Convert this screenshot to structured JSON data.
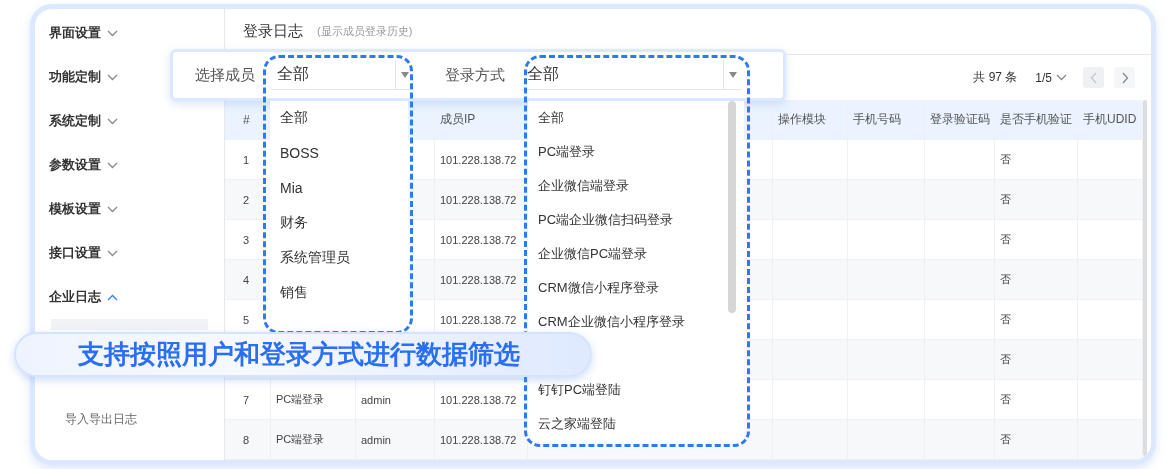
{
  "sidebar": {
    "items": [
      {
        "label": "界面设置",
        "expanded": false
      },
      {
        "label": "功能定制",
        "expanded": false
      },
      {
        "label": "系统定制",
        "expanded": false
      },
      {
        "label": "参数设置",
        "expanded": false
      },
      {
        "label": "模板设置",
        "expanded": false
      },
      {
        "label": "接口设置",
        "expanded": false
      },
      {
        "label": "企业日志",
        "expanded": true,
        "children": [
          {
            "selected": true
          },
          {
            "label": "导入导出日志",
            "selected": false
          }
        ]
      }
    ]
  },
  "header": {
    "title": "登录日志",
    "subtitle": "(显示成员登录历史)"
  },
  "pagination": {
    "total": "共 97 条",
    "page": "1/5",
    "prev_disabled": true,
    "next_disabled": false
  },
  "table": {
    "columns": [
      "#",
      null,
      null,
      "成员IP",
      null,
      "操作模块",
      "手机号码",
      "登录验证码",
      "是否手机验证",
      "手机UDID"
    ],
    "rows": [
      [
        "1",
        null,
        null,
        "101.228.138.72",
        null,
        null,
        null,
        null,
        "否",
        null
      ],
      [
        "2",
        null,
        null,
        "101.228.138.72",
        null,
        null,
        null,
        null,
        "否",
        null
      ],
      [
        "3",
        null,
        null,
        "101.228.138.72",
        null,
        null,
        null,
        null,
        "否",
        null
      ],
      [
        "4",
        null,
        null,
        "101.228.138.72",
        null,
        null,
        null,
        null,
        "否",
        null
      ],
      [
        "5",
        null,
        null,
        "101.228.138.72",
        null,
        null,
        null,
        null,
        "否",
        null
      ],
      [
        null,
        null,
        null,
        null,
        null,
        null,
        null,
        null,
        "否",
        null
      ],
      [
        "7",
        "PC端登录",
        "admin",
        "101.228.138.72",
        null,
        null,
        null,
        null,
        "否",
        null
      ],
      [
        "8",
        "PC端登录",
        "admin",
        "101.228.138.72",
        null,
        null,
        null,
        null,
        "否",
        null
      ]
    ]
  },
  "filters": [
    {
      "label": "选择成员",
      "value": "全部",
      "options": [
        "全部",
        "BOSS",
        "Mia",
        "财务",
        "系统管理员",
        "销售"
      ]
    },
    {
      "label": "登录方式",
      "value": "全部",
      "options": [
        "全部",
        "PC端登录",
        "企业微信端登录",
        "PC端企业微信扫码登录",
        "企业微信PC端登录",
        "CRM微信小程序登录",
        "CRM企业微信小程序登录",
        "钉钉PC端登陆",
        "云之家端登陆"
      ]
    }
  ],
  "banner": {
    "text": "支持按照用户和登录方式进行数据筛选"
  }
}
